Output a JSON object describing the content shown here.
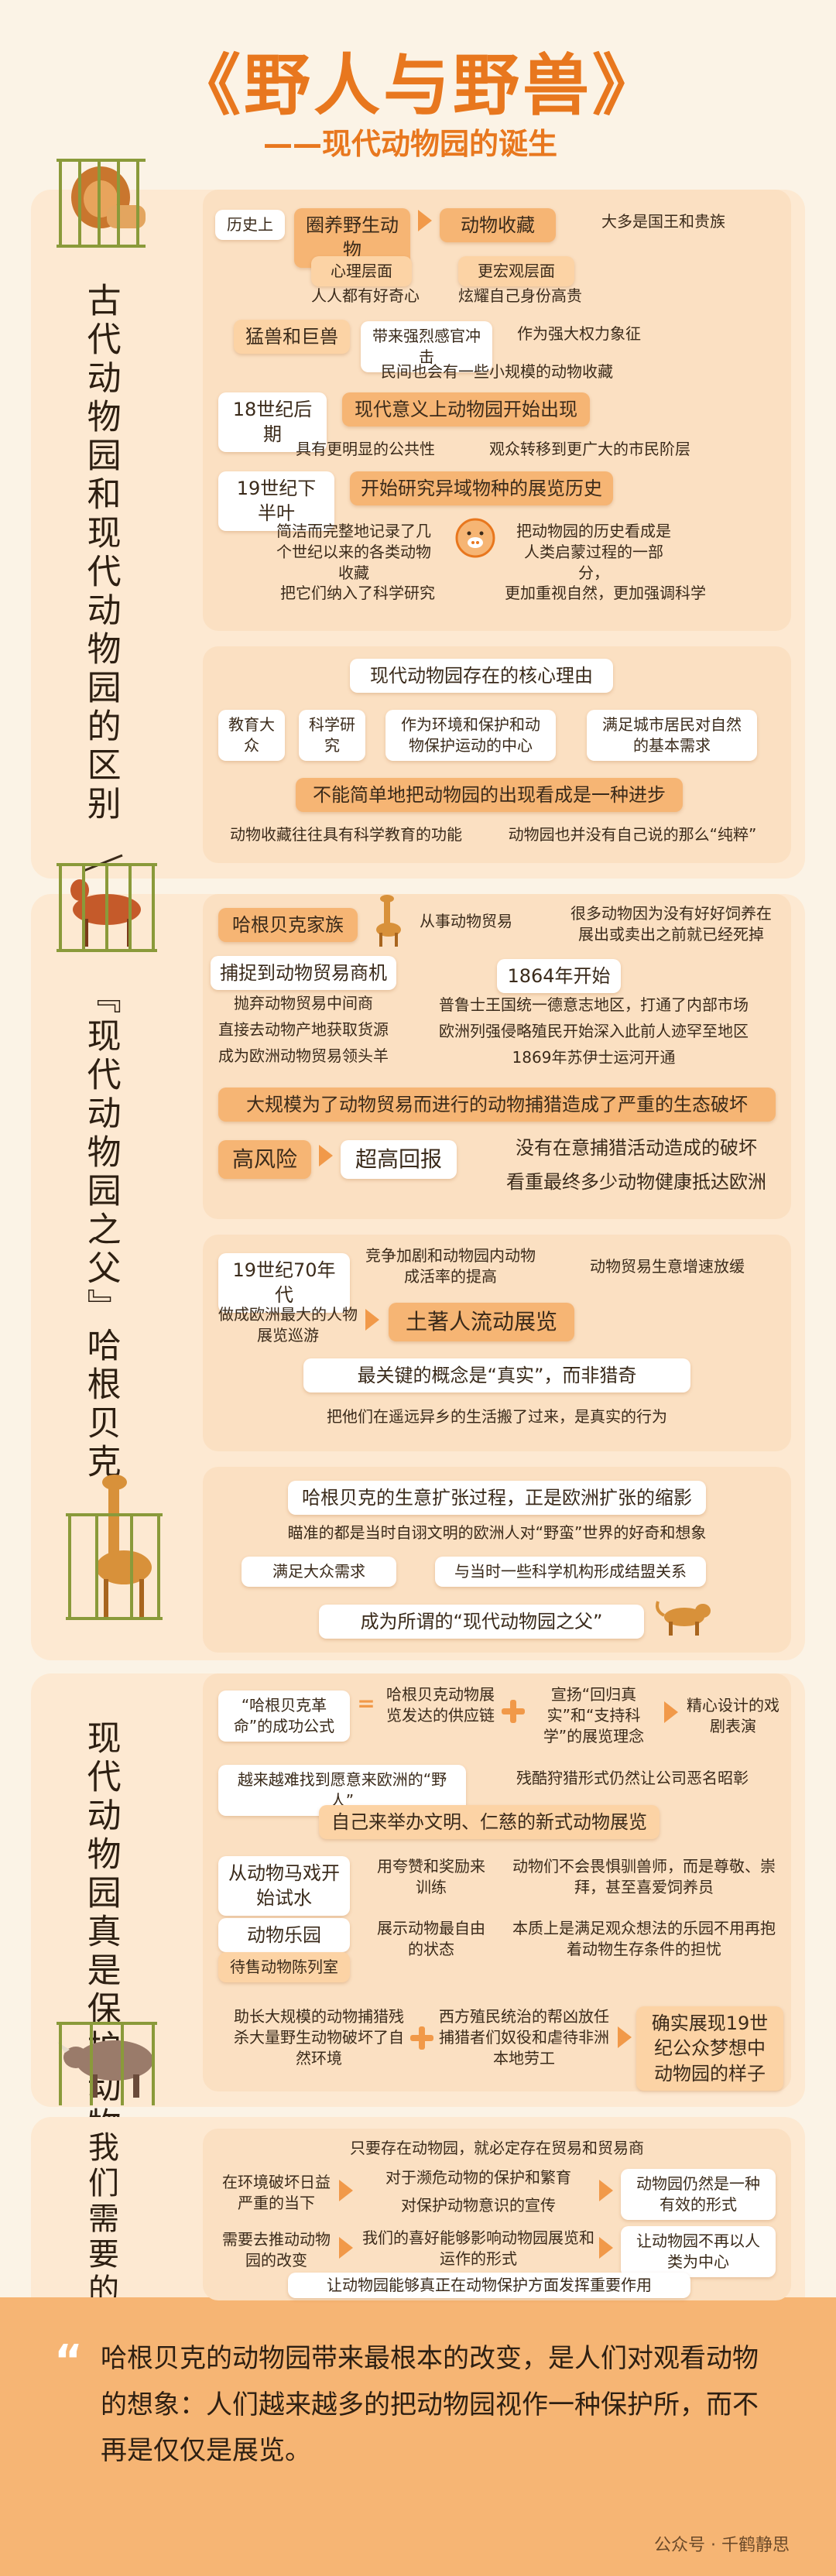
{
  "header": {
    "title": "《野人与野兽》",
    "subtitle": "——现代动物园的诞生"
  },
  "sections": {
    "s1": {
      "side_title": "古代动物园和现代动物园的区别",
      "p1": {
        "history": "历史上",
        "keep_animals": "圈养野生动物",
        "collect": "动物收藏",
        "owners": "大多是国王和贵族",
        "psych": "心理层面",
        "macro": "更宏观层面",
        "curious": "人人都有好奇心",
        "show_off": "炫耀自己身份高贵",
        "beasts": "猛兽和巨兽",
        "impact": "带来强烈感官冲击",
        "symbol": "作为强大权力象征",
        "small": "民间也会有一些小规模的动物收藏",
        "c18": "18世纪后期",
        "modern_appear": "现代意义上动物园开始出现",
        "public": "具有更明显的公共性",
        "audience": "观众转移到更广大的市民阶层",
        "c19": "19世纪下半叶",
        "research": "开始研究异域物种的展览历史",
        "record": "简洁而完整地记录了几个世纪以来的各类动物收藏",
        "history_part": "把动物园的历史看成是人类启蒙过程的一部分，",
        "science": "把它们纳入了科学研究",
        "nature": "更加重视自然，更加强调科学"
      },
      "p2": {
        "core": "现代动物园存在的核心理由",
        "r1": "教育大众",
        "r2": "科学研究",
        "r3": "作为环境和保护和动物保护运动的中心",
        "r4": "满足城市居民对自然的基本需求",
        "not_progress": "不能简单地把动物园的出现看成是一种进步",
        "edu": "动物收藏往往具有科学教育的功能",
        "not_pure": "动物园也并没有自己说的那么“纯粹”"
      }
    },
    "s2": {
      "side_title": "『现代动物园之父』哈根贝克",
      "p1": {
        "family": "哈根贝克家族",
        "trade": "从事动物贸易",
        "many_died": "很多动物因为没有好好饲养在展出或卖出之前就已经死掉",
        "merchant": "捕捉到动物贸易商机",
        "y1864": "1864年开始",
        "middle": "抛弃动物贸易中间商",
        "direct": "直接去动物产地获取货源",
        "leader": "成为欧洲动物贸易领头羊",
        "prussia": "普鲁士王国统一德意志地区，打通了内部市场",
        "colonial": "欧洲列强侵略殖民开始深入此前人迹罕至地区",
        "suez": "1869年苏伊士运河开通",
        "damage": "大规模为了动物贸易而进行的动物捕猎造成了严重的生态破坏",
        "risk": "高风险",
        "reward": "超高回报",
        "no_care": "没有在意捕猎活动造成的破坏",
        "health": "看重最终多少动物健康抵达欧洲"
      },
      "p2": {
        "c1870": "19世纪70年代",
        "competition": "竞争加剧和动物园内动物成活率的提高",
        "slowdown": "动物贸易生意增速放缓",
        "biggest": "做成欧洲最大的人物展览巡游",
        "tour": "土著人流动展览",
        "real": "最关键的概念是“真实”，而非猎奇",
        "move": "把他们在遥远异乡的生活搬了过来，是真实的行为"
      },
      "p3": {
        "expand": "哈根贝克的生意扩张过程，正是欧洲扩张的缩影",
        "aim": "瞄准的都是当时自诩文明的欧洲人对“野蛮”世界的好奇和想象",
        "mass": "满足大众需求",
        "sci_link": "与当时一些科学机构形成结盟关系",
        "father": "成为所谓的“现代动物园之父”"
      }
    },
    "s3": {
      "side_title": "现代动物园真是保护动物吗",
      "formula": "“哈根贝克革命”的成功公式",
      "supply": "哈根贝克动物展览发达的供应链",
      "concept": "宣扬“回归真实”和“支持科学”的展览理念",
      "design": "精心设计的戏剧表演",
      "hard": "越来越难找到愿意来欧洲的“野人”",
      "hunting": "残酷狩猎形式仍然让公司恶名昭彰",
      "civil": "自己来举办文明、仁慈的新式动物展览",
      "circus": "从动物马戏开始试水",
      "reward": "用夸赞和奖励来训练",
      "respect": "动物们不会畏惧驯兽师，而是尊敬、崇拜，甚至喜爱饲养员",
      "paradise": "动物乐园",
      "display": "待售动物陈列室",
      "free": "展示动物最自由的状态",
      "essence": "本质上是满足观众想法的乐园不用再抱着动物生存条件的担忧",
      "large": "助长大规模的动物捕猎残杀大量野生动物破坏了自然环境",
      "western": "西方殖民统治的帮凶放任捕猎者们奴役和虐待非洲本地劳工",
      "realize": "确实展现19世纪公众梦想中动物园的样子"
    },
    "s4": {
      "side_title": "我们需要的动物园",
      "trade": "只要存在动物园，就必定存在贸易和贸易商",
      "env": "在环境破坏日益严重的当下",
      "protect": "对于濒危动物的保护和繁育",
      "awareness": "对保护动物意识的宣传",
      "effective": "动物园仍然是一种有效的形式",
      "push": "需要去推动动物园的改变",
      "hope": "我们的喜好能够影响动物园展览和运作的形式",
      "center": "让动物园不再以人类为中心",
      "role": "让动物园能够真正在动物保护方面发挥重要作用"
    }
  },
  "footer": {
    "quote": "哈根贝克的动物园带来最根本的改变，是人们对观看动物的想象：人们越来越多的把动物园视作一种保护所，而不再是仅仅是展览。",
    "watermark": "公众号 · 千鹤静思"
  },
  "colors": {
    "accent": "#e8771e",
    "panel": "#fbe0c2",
    "section": "#fde9d2",
    "box": "#f6b574"
  }
}
